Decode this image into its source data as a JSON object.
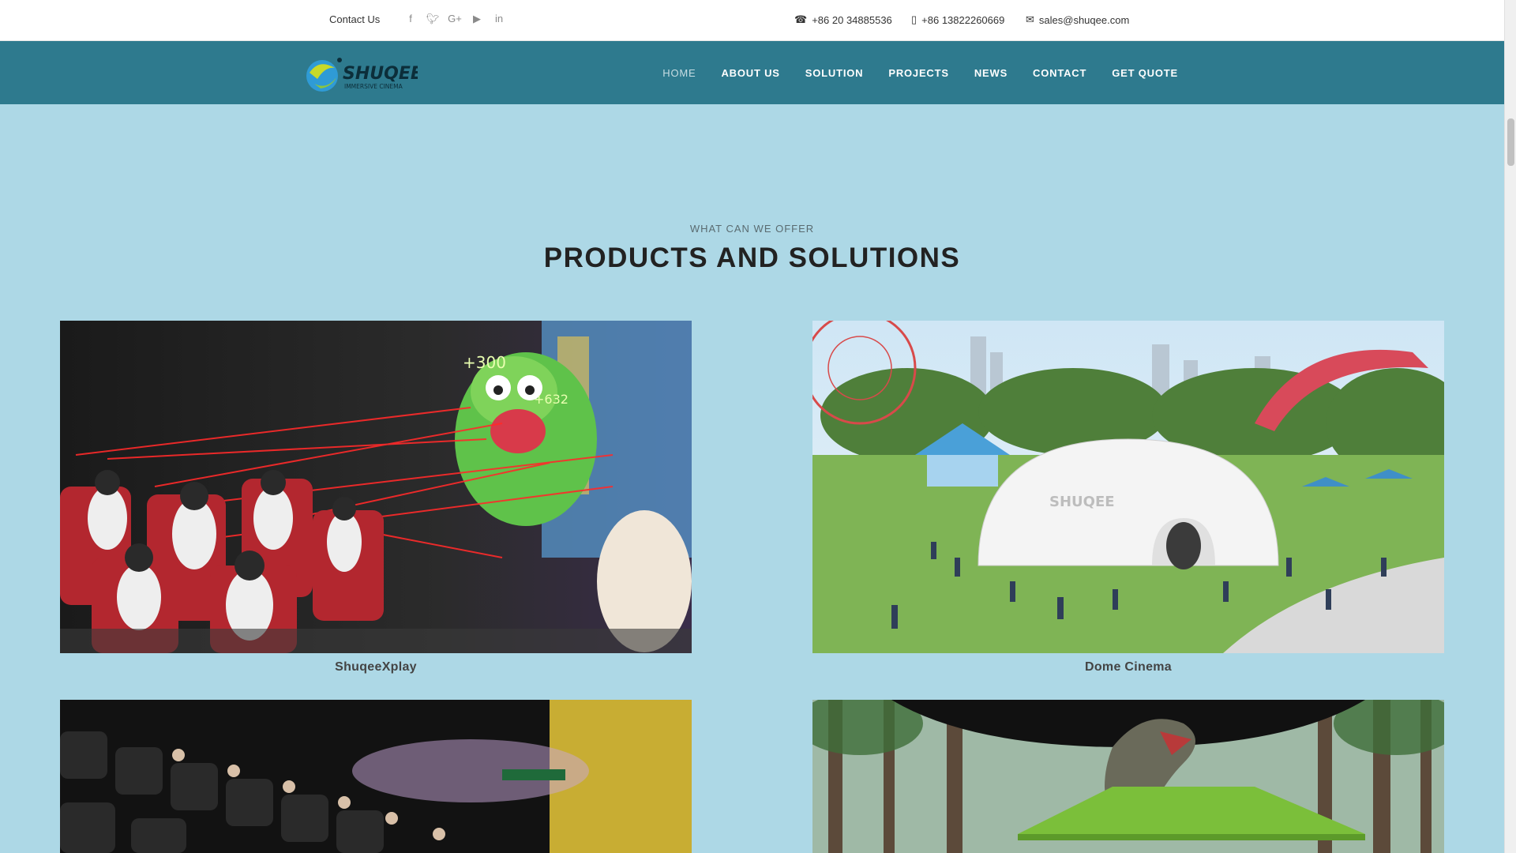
{
  "topbar": {
    "contact_label": "Contact Us",
    "social_icons": [
      "facebook-icon",
      "twitter-icon",
      "google-plus-icon",
      "youtube-icon",
      "linkedin-icon"
    ],
    "phone": "+86 20 34885536",
    "mobile": "+86 13822260669",
    "email": "sales@shuqee.com"
  },
  "brand": {
    "logo_name": "SHUQEE",
    "logo_tagline": "IMMERSIVE CINEMA"
  },
  "nav": {
    "items": [
      "HOME",
      "ABOUT US",
      "SOLUTION",
      "PROJECTS",
      "NEWS",
      "CONTACT",
      "GET QUOTE"
    ],
    "active": "HOME"
  },
  "section": {
    "eyebrow": "WHAT CAN WE OFFER",
    "title": "PRODUCTS AND SOLUTIONS"
  },
  "products": [
    {
      "caption": "ShuqeeXplay",
      "image": "laser shooting 4D cinema with cartoon monsters"
    },
    {
      "caption": "Dome Cinema",
      "image": "white dome cinema in amusement park"
    },
    {
      "caption": "",
      "image": "4D cinema hall with audience in 3D glasses"
    },
    {
      "caption": "",
      "image": "dinosaur in forest immersive theater"
    }
  ],
  "colors": {
    "page_bg": "#add8e6",
    "nav_bg": "#2e7a8e",
    "topbar_bg": "#ffffff"
  }
}
